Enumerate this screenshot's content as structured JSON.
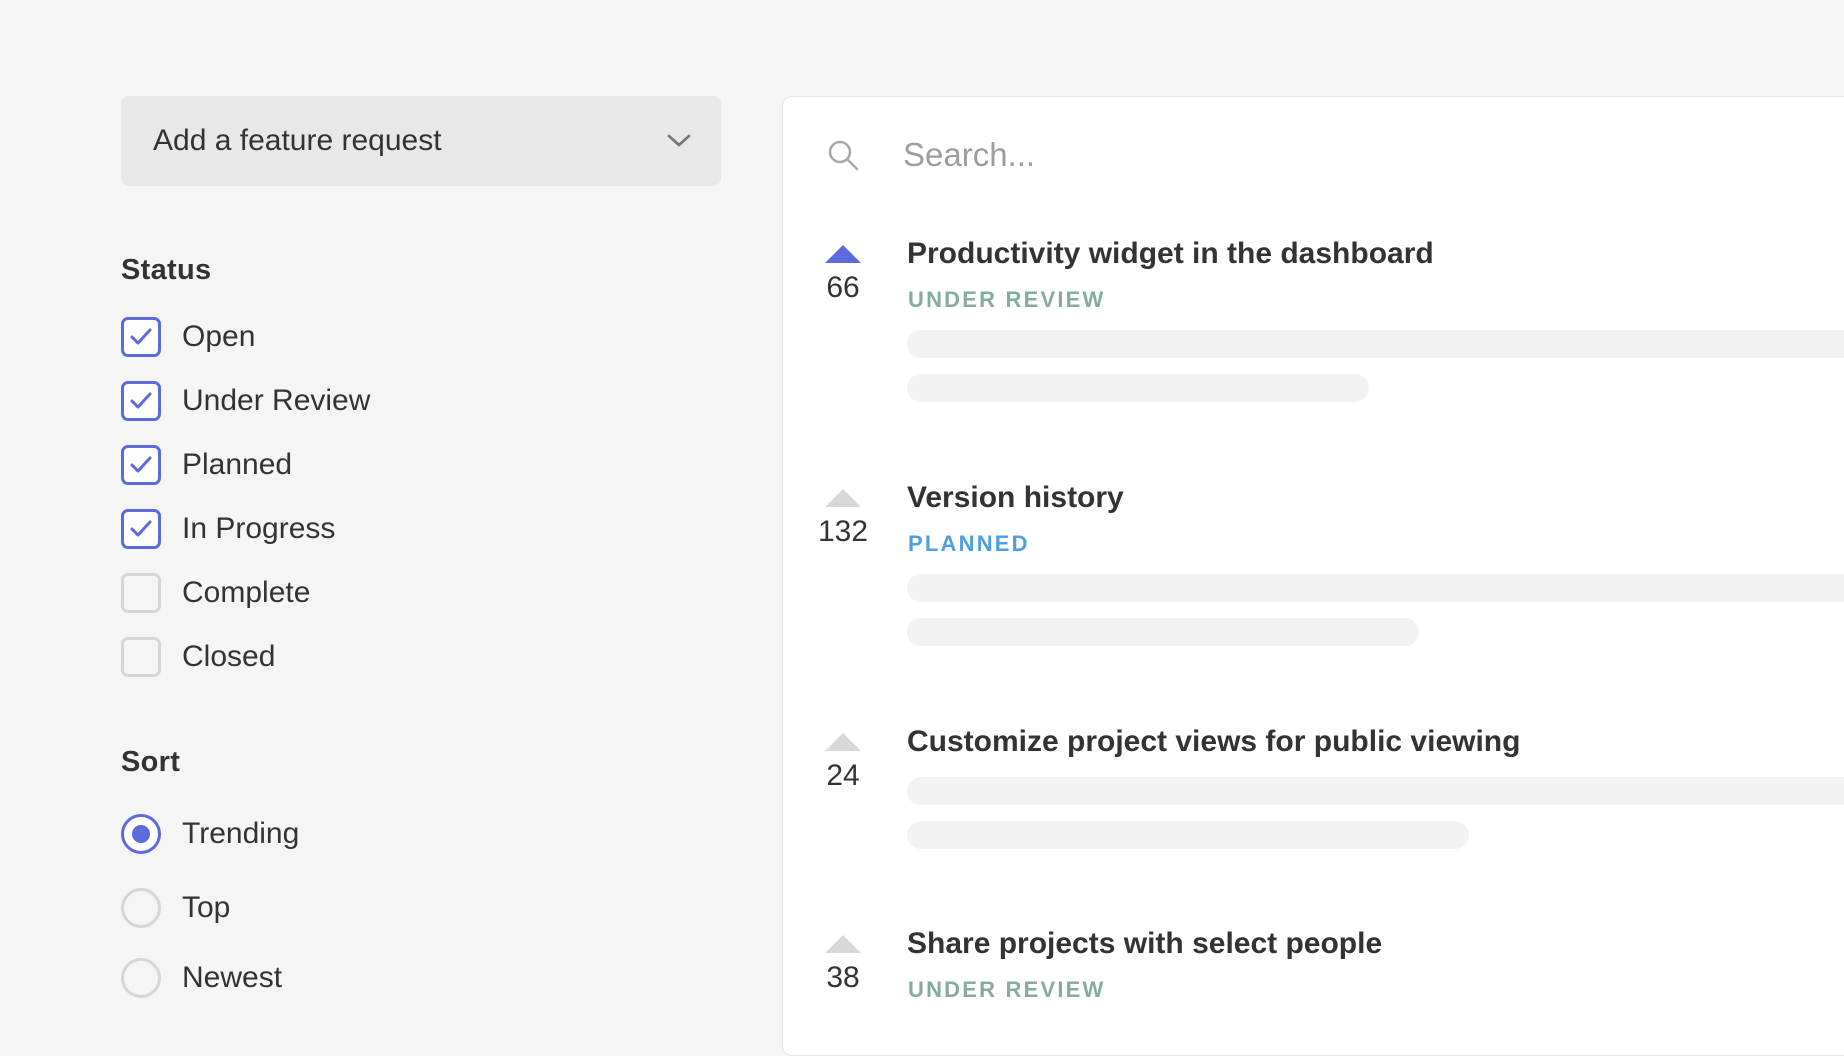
{
  "sidebar": {
    "add_request_label": "Add a feature request",
    "status_title": "Status",
    "status_options": [
      {
        "label": "Open",
        "checked": true
      },
      {
        "label": "Under Review",
        "checked": true
      },
      {
        "label": "Planned",
        "checked": true
      },
      {
        "label": "In Progress",
        "checked": true
      },
      {
        "label": "Complete",
        "checked": false
      },
      {
        "label": "Closed",
        "checked": false
      }
    ],
    "sort_title": "Sort",
    "sort_options": [
      {
        "label": "Trending",
        "selected": true
      },
      {
        "label": "Top",
        "selected": false
      },
      {
        "label": "Newest",
        "selected": false
      }
    ]
  },
  "search": {
    "placeholder": "Search..."
  },
  "posts": [
    {
      "votes": "66",
      "voted": true,
      "title": "Productivity widget in the dashboard",
      "status": "UNDER REVIEW",
      "status_color": "#86aba3"
    },
    {
      "votes": "132",
      "voted": false,
      "title": "Version history",
      "status": "PLANNED",
      "status_color": "#4f9fe0"
    },
    {
      "votes": "24",
      "voted": false,
      "title": "Customize project views for public viewing",
      "status": "",
      "status_color": ""
    },
    {
      "votes": "38",
      "voted": false,
      "title": "Share projects with select people",
      "status": "UNDER REVIEW",
      "status_color": "#86aba3"
    }
  ],
  "colors": {
    "accent": "#5b6adc",
    "background": "#f5f5f5",
    "panel": "#ffffff",
    "skeleton": "#f2f2f2"
  }
}
